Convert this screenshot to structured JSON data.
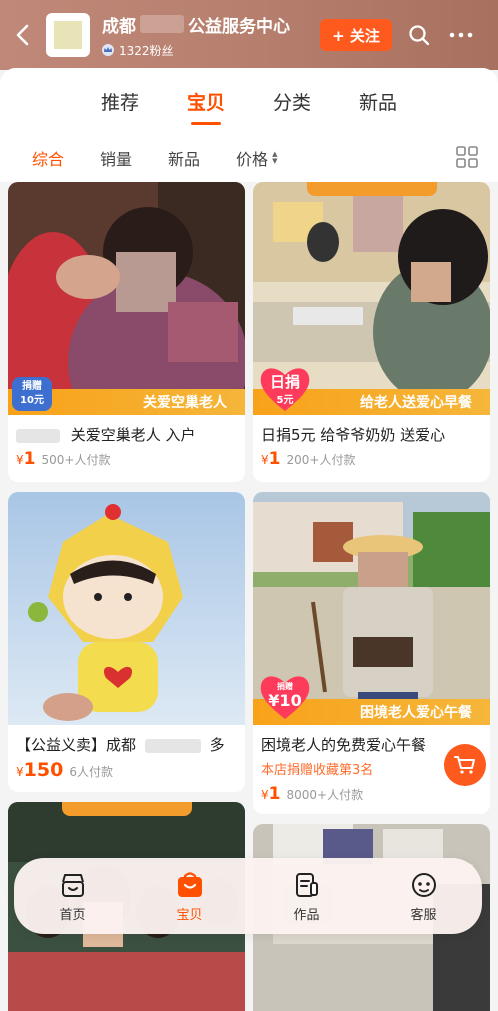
{
  "header": {
    "shop_name_prefix": "成都",
    "shop_name_suffix": "公益服务中心",
    "fans": "1322粉丝",
    "follow_label": "+ 关注"
  },
  "tabs": [
    {
      "label": "推荐",
      "active": false
    },
    {
      "label": "宝贝",
      "active": true
    },
    {
      "label": "分类",
      "active": false
    },
    {
      "label": "新品",
      "active": false
    }
  ],
  "sort": [
    {
      "label": "综合",
      "active": true
    },
    {
      "label": "销量",
      "active": false
    },
    {
      "label": "新品",
      "active": false
    },
    {
      "label": "价格",
      "active": false
    }
  ],
  "products": [
    {
      "title": "关爱空巢老人 入户",
      "banner": "关爱空巢老人",
      "badge": "捐赠\n10元",
      "price_symbol": "¥",
      "price": "1",
      "sold": "500+人付款"
    },
    {
      "title": "日捐5元 给爷爷奶奶 送爱心",
      "banner": "给老人送爱心早餐",
      "badge_top": "日捐",
      "badge_bottom": "5元",
      "price_symbol": "¥",
      "price": "1",
      "sold": "200+人付款"
    },
    {
      "title": "【公益义卖】成都",
      "title_tail": "多",
      "price_symbol": "¥",
      "price": "150",
      "sold": "6人付款"
    },
    {
      "title": "困境老人的免费爱心午餐",
      "banner": "困境老人爱心午餐",
      "badge_top": "捐赠",
      "badge_bottom": "¥10",
      "rank": "本店捐赠收藏第3名",
      "price_symbol": "¥",
      "price": "1",
      "sold": "8000+人付款"
    }
  ],
  "bottom_nav": [
    {
      "label": "首页",
      "active": false,
      "icon": "shop-home-icon"
    },
    {
      "label": "宝贝",
      "active": true,
      "icon": "shopping-bag-icon"
    },
    {
      "label": "作品",
      "active": false,
      "icon": "works-icon"
    },
    {
      "label": "客服",
      "active": false,
      "icon": "customer-service-icon"
    }
  ],
  "colors": {
    "accent": "#ff5000",
    "header": "#b8806f",
    "banner": "#f8a21a"
  }
}
